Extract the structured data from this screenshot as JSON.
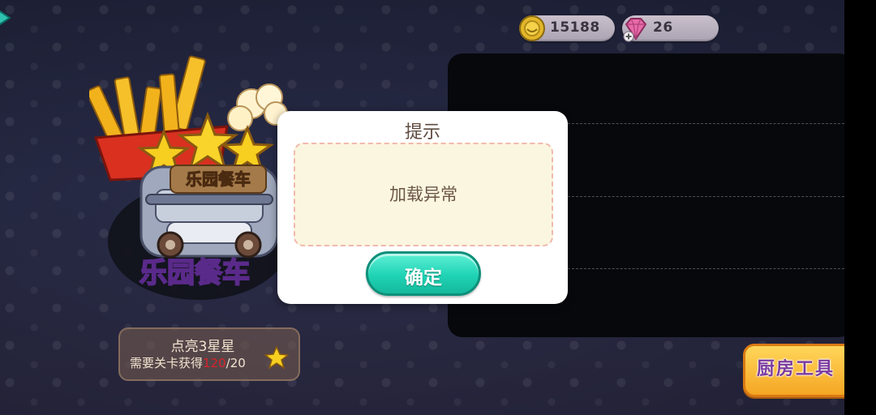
{
  "currency": {
    "coins": "15188",
    "gems": "26"
  },
  "event": {
    "emblem_name": "乐园餐车",
    "logo_text": "乐园餐车",
    "star_goal_title": "点亮3星星",
    "star_req_prefix": "需要关卡获得",
    "star_req_current": "120",
    "star_req_sep": "/",
    "star_req_total": "20"
  },
  "kitchen": {
    "label": "厨房工具"
  },
  "dialog": {
    "title": "提示",
    "message": "加载异常",
    "confirm_label": "确定"
  },
  "colors": {
    "confirm_green": "#1fd3b4",
    "req_red": "#d8232a",
    "kitchen_orange": "#f5a623"
  }
}
